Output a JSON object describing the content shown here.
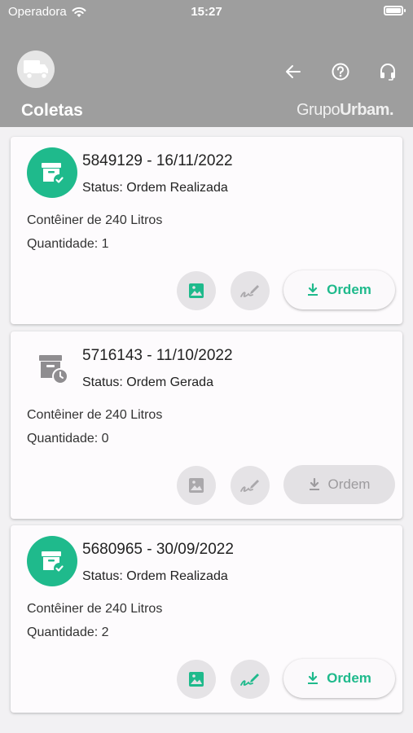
{
  "status_bar": {
    "carrier": "Operadora",
    "time": "15:27"
  },
  "header": {
    "title": "Coletas",
    "brand_prefix": "Grupo",
    "brand_suffix": "Urbam."
  },
  "colors": {
    "accent": "#1fba8c",
    "header_bg": "#9e9e9e",
    "disabled": "#9d9b9e"
  },
  "cards": [
    {
      "title": "5849129 - 16/11/2022",
      "status": "Status: Ordem Realizada",
      "container": "Contêiner de 240 Litros",
      "quantity": "Quantidade: 1",
      "order_label": "Ordem",
      "state": "done"
    },
    {
      "title": "5716143 - 11/10/2022",
      "status": "Status: Ordem Gerada",
      "container": "Contêiner de 240 Litros",
      "quantity": "Quantidade: 0",
      "order_label": "Ordem",
      "state": "pending"
    },
    {
      "title": "5680965 - 30/09/2022",
      "status": "Status: Ordem Realizada",
      "container": "Contêiner de 240 Litros",
      "quantity": "Quantidade: 2",
      "order_label": "Ordem",
      "state": "done"
    }
  ]
}
